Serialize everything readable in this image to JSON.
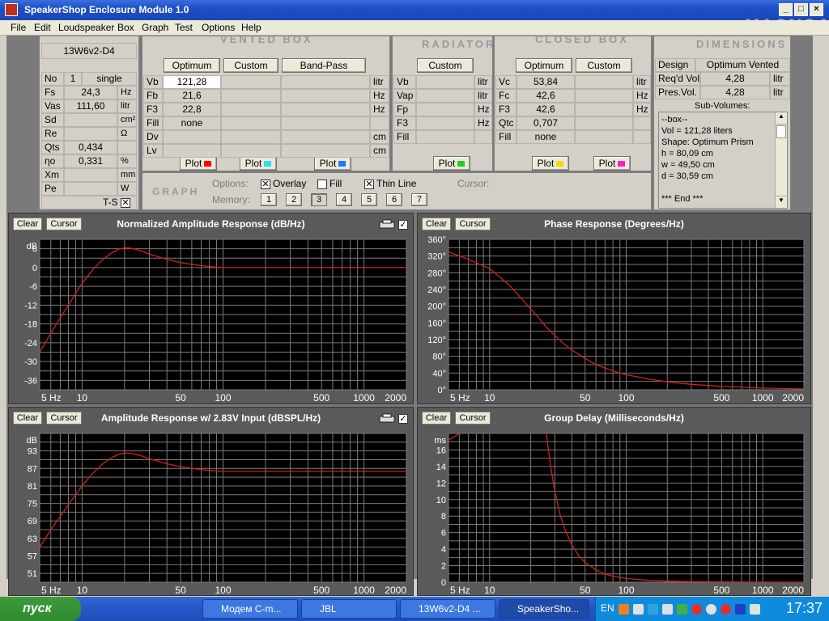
{
  "window": {
    "title": "SpeakerShop Enclosure Module 1.0",
    "watermark": "MAGNOA"
  },
  "menu": [
    "File",
    "Edit",
    "Loudspeaker",
    "Box",
    "Graph",
    "Test",
    "Options",
    "Help"
  ],
  "driver": {
    "name": "13W6v2-D4",
    "no_label": "No",
    "no_value": "1",
    "no_mode": "single",
    "params": [
      {
        "label": "Fs",
        "value": "24,3",
        "unit": "Hz"
      },
      {
        "label": "Vas",
        "value": "111,60",
        "unit": "litr"
      },
      {
        "label": "Sd",
        "value": "",
        "unit": "cm²"
      },
      {
        "label": "Re",
        "value": "",
        "unit": "Ω"
      },
      {
        "label": "Qts",
        "value": "0,434",
        "unit": ""
      },
      {
        "label": "ηo",
        "value": "0,331",
        "unit": "%"
      },
      {
        "label": "Xm",
        "value": "",
        "unit": "mm"
      },
      {
        "label": "Pe",
        "value": "",
        "unit": "W"
      }
    ],
    "ts_label": "T-S"
  },
  "vented": {
    "header": "VENTED BOX",
    "buttons": [
      "Optimum",
      "Custom",
      "Band-Pass"
    ],
    "rows": [
      {
        "label": "Vb",
        "col1": "121,28",
        "unit": "litr"
      },
      {
        "label": "Fb",
        "col1": "21,6",
        "unit": "Hz"
      },
      {
        "label": "F3",
        "col1": "22,8",
        "unit": "Hz"
      },
      {
        "label": "Fill",
        "col1": "none",
        "unit": ""
      },
      {
        "label": "Dv",
        "col1": "",
        "unit": "cm"
      },
      {
        "label": "Lv",
        "col1": "",
        "unit": "cm"
      }
    ],
    "plot_label": "Plot",
    "plot_colors": [
      "#ff0000",
      "#33ddee",
      "#1e78ff"
    ]
  },
  "radiator": {
    "header": "RADIATOR",
    "button": "Custom",
    "rows": [
      {
        "label": "Vb",
        "unit": "litr"
      },
      {
        "label": "Vap",
        "unit": "litr"
      },
      {
        "label": "Fp",
        "unit": "Hz"
      },
      {
        "label": "F3",
        "unit": "Hz"
      },
      {
        "label": "Fill",
        "unit": ""
      }
    ],
    "plot_label": "Plot",
    "plot_color": "#22cc22"
  },
  "closed": {
    "header": "CLOSED BOX",
    "buttons": [
      "Optimum",
      "Custom"
    ],
    "rows": [
      {
        "label": "Vc",
        "col1": "53,84",
        "unit": "litr"
      },
      {
        "label": "Fc",
        "col1": "42,6",
        "unit": "Hz"
      },
      {
        "label": "F3",
        "col1": "42,6",
        "unit": "Hz"
      },
      {
        "label": "Qtc",
        "col1": "0,707",
        "unit": ""
      },
      {
        "label": "Fill",
        "col1": "none",
        "unit": ""
      }
    ],
    "plot_label": "Plot",
    "plot_colors": [
      "#eedd00",
      "#ee22cc"
    ]
  },
  "dimensions": {
    "header": "DIMENSIONS",
    "design_label": "Design",
    "design_value": "Optimum Vented",
    "reqd_label": "Req'd Vol.",
    "reqd_value": "4,28",
    "reqd_unit": "litr",
    "pres_label": "Pres.Vol.",
    "pres_value": "4,28",
    "pres_unit": "litr",
    "subvol_title": "Sub-Volumes:",
    "subvol_lines": [
      "--box--",
      "Vol = 121,28 liters",
      "Shape: Optimum Prism",
      "h = 80,09 cm",
      "w = 49,50 cm",
      "d = 30,59 cm",
      "",
      "*** End ***"
    ]
  },
  "graph_panel": {
    "header": "GRAPH",
    "options_label": "Options:",
    "overlay_label": "Overlay",
    "overlay_checked": true,
    "fill_label": "Fill",
    "fill_checked": false,
    "thinline_label": "Thin Line",
    "thinline_checked": true,
    "memory_label": "Memory:",
    "memory_slots": [
      "1",
      "2",
      "3",
      "4",
      "5",
      "6",
      "7"
    ],
    "active_memory": "3",
    "cursor_label": "Cursor:"
  },
  "graph_buttons": {
    "clear": "Clear",
    "cursor": "Cursor"
  },
  "chart_data": [
    {
      "type": "line",
      "title": "Normalized Amplitude Response (dB/Hz)",
      "unit_label": "dB",
      "xscale": "log",
      "xlim": [
        5,
        2000
      ],
      "xticks": [
        {
          "v": 5,
          "t": "5 Hz"
        },
        {
          "v": 10,
          "t": "10"
        },
        {
          "v": 50,
          "t": "50"
        },
        {
          "v": 100,
          "t": "100"
        },
        {
          "v": 500,
          "t": "500"
        },
        {
          "v": 1000,
          "t": "1000"
        },
        {
          "v": 2000,
          "t": "2000"
        }
      ],
      "ylim": [
        -39,
        9
      ],
      "yticks": [
        6,
        0,
        -6,
        -12,
        -18,
        -24,
        -30,
        -36
      ],
      "series": [
        {
          "color": "#cc2222",
          "x": [
            5,
            6,
            7,
            8,
            10,
            12,
            14,
            16,
            18,
            20,
            22,
            24,
            26,
            30,
            35,
            40,
            50,
            60,
            70,
            80,
            100,
            150,
            200,
            500,
            1000,
            2000
          ],
          "y": [
            -27,
            -21,
            -16,
            -12,
            -5,
            -0.5,
            2.5,
            4.5,
            5.8,
            6.3,
            6.2,
            5.8,
            5.4,
            4.3,
            3.4,
            2.6,
            1.6,
            1,
            0.6,
            0.3,
            0,
            0,
            0,
            0,
            0,
            0
          ]
        }
      ]
    },
    {
      "type": "line",
      "title": "Phase Response (Degrees/Hz)",
      "unit_label": "",
      "xscale": "log",
      "xlim": [
        5,
        2000
      ],
      "xticks": [
        {
          "v": 5,
          "t": "5 Hz"
        },
        {
          "v": 10,
          "t": "10"
        },
        {
          "v": 50,
          "t": "50"
        },
        {
          "v": 100,
          "t": "100"
        },
        {
          "v": 500,
          "t": "500"
        },
        {
          "v": 1000,
          "t": "1000"
        },
        {
          "v": 2000,
          "t": "2000"
        }
      ],
      "ylim": [
        0,
        360
      ],
      "yticks": [
        360,
        320,
        280,
        240,
        200,
        160,
        120,
        80,
        40,
        0
      ],
      "ytick_suffix": "°",
      "series": [
        {
          "color": "#cc2222",
          "x": [
            5,
            7,
            10,
            14,
            18,
            22,
            26,
            30,
            35,
            40,
            50,
            60,
            80,
            100,
            150,
            200,
            300,
            500,
            1000,
            2000
          ],
          "y": [
            330,
            312,
            290,
            250,
            210,
            178,
            150,
            130,
            110,
            95,
            75,
            60,
            45,
            36,
            25,
            19,
            13,
            8,
            4,
            2
          ]
        }
      ]
    },
    {
      "type": "line",
      "title": "Amplitude Response w/ 2.83V Input (dBSPL/Hz)",
      "unit_label": "dB",
      "xscale": "log",
      "xlim": [
        5,
        2000
      ],
      "xticks": [
        {
          "v": 5,
          "t": "5 Hz"
        },
        {
          "v": 10,
          "t": "10"
        },
        {
          "v": 50,
          "t": "50"
        },
        {
          "v": 100,
          "t": "100"
        },
        {
          "v": 500,
          "t": "500"
        },
        {
          "v": 1000,
          "t": "1000"
        },
        {
          "v": 2000,
          "t": "2000"
        }
      ],
      "ylim": [
        48,
        99
      ],
      "yticks": [
        93,
        87,
        81,
        75,
        69,
        63,
        57,
        51
      ],
      "series": [
        {
          "color": "#cc2222",
          "x": [
            5,
            6,
            7,
            8,
            10,
            12,
            14,
            16,
            18,
            20,
            22,
            24,
            26,
            30,
            35,
            40,
            50,
            60,
            70,
            80,
            100,
            150,
            200,
            500,
            1000,
            2000
          ],
          "y": [
            60,
            66,
            70.5,
            74.5,
            81,
            85.5,
            88.5,
            90.5,
            91.8,
            92.3,
            92.2,
            91.8,
            91.4,
            90.3,
            89.4,
            88.6,
            87.6,
            87,
            86.6,
            86.3,
            86,
            86,
            86,
            86,
            86,
            86
          ]
        }
      ]
    },
    {
      "type": "line",
      "title": "Group Delay (Milliseconds/Hz)",
      "unit_label": "ms",
      "xscale": "log",
      "xlim": [
        5,
        2000
      ],
      "xticks": [
        {
          "v": 5,
          "t": "5 Hz"
        },
        {
          "v": 10,
          "t": "10"
        },
        {
          "v": 50,
          "t": "50"
        },
        {
          "v": 100,
          "t": "100"
        },
        {
          "v": 500,
          "t": "500"
        },
        {
          "v": 1000,
          "t": "1000"
        },
        {
          "v": 2000,
          "t": "2000"
        }
      ],
      "ylim": [
        0,
        18
      ],
      "yticks": [
        16,
        14,
        12,
        10,
        8,
        6,
        4,
        2,
        0
      ],
      "series": [
        {
          "color": "#cc2222",
          "x": [
            5,
            5.5,
            6
          ],
          "y": [
            17.2,
            17.6,
            18
          ]
        },
        {
          "color": "#cc2222",
          "x": [
            26,
            28,
            30,
            33,
            36,
            40,
            45,
            50,
            60,
            70,
            80,
            100,
            150,
            200,
            300,
            500,
            1000,
            2000
          ],
          "y": [
            18,
            14,
            11,
            8,
            6.2,
            4.5,
            3.2,
            2.4,
            1.5,
            1,
            0.7,
            0.45,
            0.22,
            0.13,
            0.07,
            0.03,
            0.01,
            0
          ]
        }
      ]
    }
  ],
  "taskbar": {
    "start_label": "пуск",
    "tasks": [
      "Модем С-m...",
      "JBL",
      "13W6v2-D4 ...",
      "SpeakerSho..."
    ],
    "lang": "EN",
    "clock": "17:37"
  },
  "colors": {
    "titlebar": "#1d4fc4",
    "plot_bg": "#000000",
    "grid": "#7a7a7a",
    "curve": "#cc2222",
    "taskbar": "#2457c8"
  }
}
